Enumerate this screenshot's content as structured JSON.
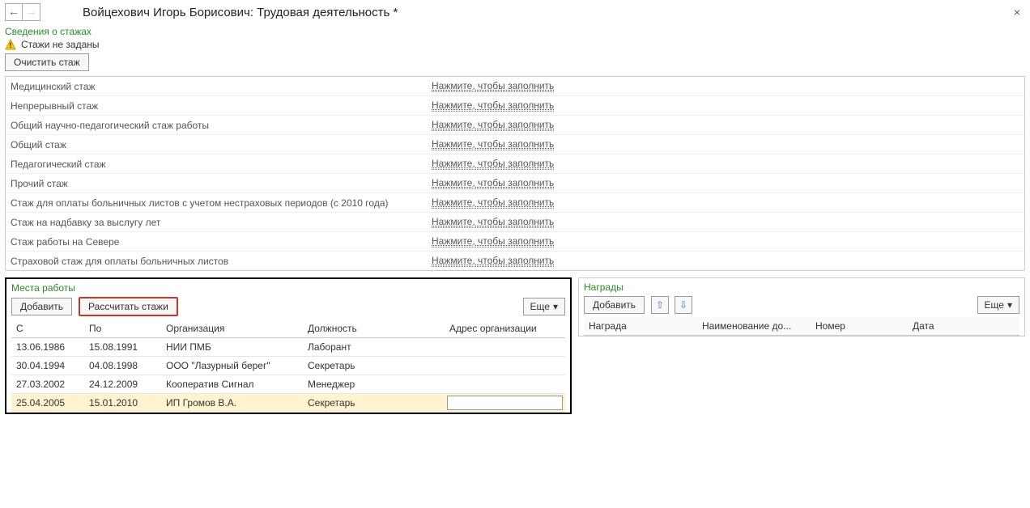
{
  "header": {
    "title": "Войцехович Игорь Борисович: Трудовая деятельность *"
  },
  "experience_section": {
    "title": "Сведения о стажах",
    "warning": "Стажи не заданы",
    "clear_button": "Очистить стаж",
    "fill_link": "Нажмите, чтобы заполнить",
    "rows": [
      "Медицинский стаж",
      "Непрерывный стаж",
      "Общий научно-педагогический стаж работы",
      "Общий стаж",
      "Педагогический стаж",
      "Прочий стаж",
      "Стаж для оплаты больничных листов с учетом нестраховых периодов (с 2010 года)",
      "Стаж на надбавку за выслугу лет",
      "Стаж работы на Севере",
      "Страховой стаж для оплаты больничных листов"
    ]
  },
  "workplaces": {
    "title": "Места работы",
    "add_button": "Добавить",
    "calc_button": "Рассчитать стажи",
    "more_button": "Еще",
    "columns": {
      "from": "С",
      "to": "По",
      "org": "Организация",
      "post": "Должность",
      "addr": "Адрес организации"
    },
    "rows": [
      {
        "from": "13.06.1986",
        "to": "15.08.1991",
        "org": "НИИ ПМБ",
        "post": "Лаборант",
        "addr": ""
      },
      {
        "from": "30.04.1994",
        "to": "04.08.1998",
        "org": "ООО \"Лазурный берег\"",
        "post": "Секретарь",
        "addr": ""
      },
      {
        "from": "27.03.2002",
        "to": "24.12.2009",
        "org": "Кооператив Сигнал",
        "post": "Менеджер",
        "addr": ""
      },
      {
        "from": "25.04.2005",
        "to": "15.01.2010",
        "org": "ИП Громов В.А.",
        "post": "Секретарь",
        "addr": ""
      }
    ],
    "selected_index": 3
  },
  "awards": {
    "title": "Награды",
    "add_button": "Добавить",
    "more_button": "Еще",
    "columns": {
      "award": "Награда",
      "doc": "Наименование до...",
      "number": "Номер",
      "date": "Дата"
    },
    "rows": []
  }
}
